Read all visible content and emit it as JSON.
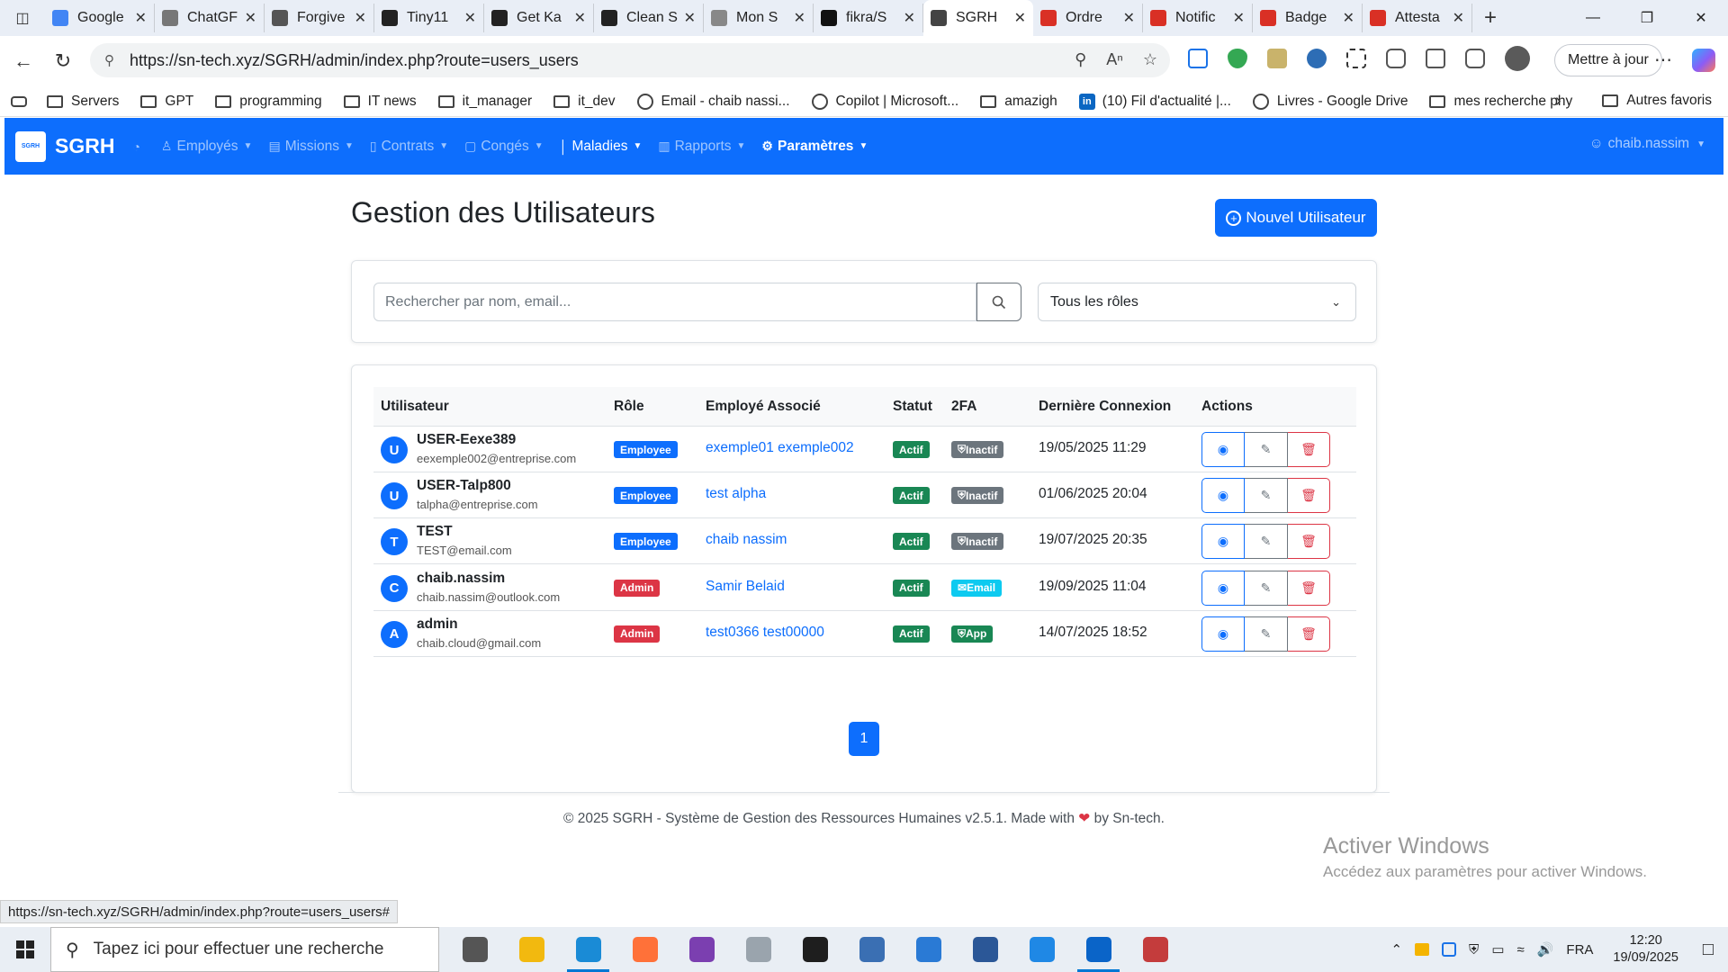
{
  "browser": {
    "tabs": [
      {
        "label": "Google",
        "icon": "gemini-icon",
        "color": "#4285f4"
      },
      {
        "label": "ChatGF",
        "icon": "chatgpt-icon",
        "color": "#777777"
      },
      {
        "label": "Forgive",
        "icon": "drive-icon",
        "color": "#555555"
      },
      {
        "label": "Tiny11",
        "icon": "tiny11-icon",
        "color": "#222222"
      },
      {
        "label": "Get Ka",
        "icon": "tool-icon",
        "color": "#222222"
      },
      {
        "label": "Clean S",
        "icon": "openai-icon",
        "color": "#222222"
      },
      {
        "label": "Mon S",
        "icon": "globe-icon",
        "color": "#888888"
      },
      {
        "label": "fikra/S",
        "icon": "github-icon",
        "color": "#111111"
      },
      {
        "label": "SGRH",
        "icon": "globe-icon",
        "color": "#444444",
        "active": true
      },
      {
        "label": "Ordre",
        "icon": "pdf-icon",
        "color": "#d93025"
      },
      {
        "label": "Notific",
        "icon": "pdf-icon",
        "color": "#d93025"
      },
      {
        "label": "Badge",
        "icon": "pdf-icon",
        "color": "#d93025"
      },
      {
        "label": "Attesta",
        "icon": "pdf-icon",
        "color": "#d93025"
      }
    ],
    "url": "https://sn-tech.xyz/SGRH/admin/index.php?route=users_users",
    "update_label": "Mettre à jour",
    "bookmarks": [
      {
        "label": "Servers",
        "type": "folder"
      },
      {
        "label": "GPT",
        "type": "folder"
      },
      {
        "label": "programming",
        "type": "folder"
      },
      {
        "label": "IT news",
        "type": "folder"
      },
      {
        "label": "it_manager",
        "type": "folder"
      },
      {
        "label": "it_dev",
        "type": "folder"
      },
      {
        "label": "Email - chaib nassi...",
        "type": "globe"
      },
      {
        "label": "Copilot | Microsoft...",
        "type": "globe"
      },
      {
        "label": "amazigh",
        "type": "folder"
      },
      {
        "label": "(10) Fil d'actualité |...",
        "type": "linkedin"
      },
      {
        "label": "Livres - Google Drive",
        "type": "globe"
      },
      {
        "label": "mes recherche phy",
        "type": "folder"
      }
    ],
    "other_bookmarks": "Autres favoris",
    "status_url": "https://sn-tech.xyz/SGRH/admin/index.php?route=users_users#"
  },
  "app": {
    "brand": "SGRH",
    "logo_text": "SGRH",
    "nav": [
      {
        "label": "",
        "icon": "dashboard-icon"
      },
      {
        "label": "Employés",
        "icon": "users-icon"
      },
      {
        "label": "Missions",
        "icon": "briefcase-icon"
      },
      {
        "label": "Contrats",
        "icon": "file-icon"
      },
      {
        "label": "Congés",
        "icon": "calendar-icon"
      },
      {
        "label": "Maladies",
        "icon": "thermometer-icon"
      },
      {
        "label": "Rapports",
        "icon": "report-icon"
      },
      {
        "label": "Paramètres",
        "icon": "gear-icon"
      }
    ],
    "user": "chaib.nassim"
  },
  "page": {
    "title": "Gestion des Utilisateurs",
    "new_user_label": "Nouvel Utilisateur",
    "search_placeholder": "Rechercher par nom, email...",
    "role_filter": "Tous les rôles"
  },
  "table": {
    "headers": [
      "Utilisateur",
      "Rôle",
      "Employé Associé",
      "Statut",
      "2FA",
      "Dernière Connexion",
      "Actions"
    ],
    "rows": [
      {
        "initial": "U",
        "name": "USER-Eexe389",
        "email": "eexemple002@entreprise.com",
        "role": "Employee",
        "employee": "exemple01 exemple002",
        "status": "Actif",
        "twofa": "Inactif",
        "last_login": "19/05/2025 11:29"
      },
      {
        "initial": "U",
        "name": "USER-Talp800",
        "email": "talpha@entreprise.com",
        "role": "Employee",
        "employee": "test alpha",
        "status": "Actif",
        "twofa": "Inactif",
        "last_login": "01/06/2025 20:04"
      },
      {
        "initial": "T",
        "name": "TEST",
        "email": "TEST@email.com",
        "role": "Employee",
        "employee": "chaib nassim",
        "status": "Actif",
        "twofa": "Inactif",
        "last_login": "19/07/2025 20:35"
      },
      {
        "initial": "C",
        "name": "chaib.nassim",
        "email": "chaib.nassim@outlook.com",
        "role": "Admin",
        "employee": "Samir Belaid",
        "status": "Actif",
        "twofa": "Email",
        "last_login": "19/09/2025 11:04"
      },
      {
        "initial": "A",
        "name": "admin",
        "email": "chaib.cloud@gmail.com",
        "role": "Admin",
        "employee": "test0366 test00000",
        "status": "Actif",
        "twofa": "App",
        "last_login": "14/07/2025 18:52"
      }
    ],
    "current_page": "1"
  },
  "footer": {
    "before": "© 2025 SGRH - Système de Gestion des Ressources Humaines v2.5.1. Made with",
    "after": "by Sn-tech."
  },
  "watermark": {
    "line1": "Activer Windows",
    "line2": "Accédez aux paramètres pour activer Windows."
  },
  "taskbar": {
    "search_placeholder": "Tapez ici pour effectuer une recherche",
    "lang": "FRA",
    "time": "12:20",
    "date": "19/09/2025",
    "apps": [
      {
        "name": "task-view-icon",
        "color": "#555555"
      },
      {
        "name": "file-explorer-icon",
        "color": "#f2b90f"
      },
      {
        "name": "edge-icon",
        "color": "#1a8bd6",
        "open": true
      },
      {
        "name": "firefox-icon",
        "color": "#ff7139"
      },
      {
        "name": "github-desktop-icon",
        "color": "#7b3fb0"
      },
      {
        "name": "app-icon",
        "color": "#9aa4ad"
      },
      {
        "name": "terminal-icon",
        "color": "#1e1e1e"
      },
      {
        "name": "network-app-icon",
        "color": "#3a6fb3"
      },
      {
        "name": "remote-app-icon",
        "color": "#2a7ad5"
      },
      {
        "name": "powershell-icon",
        "color": "#2b5797"
      },
      {
        "name": "vscode-icon",
        "color": "#1f88e5"
      },
      {
        "name": "outlook-icon",
        "color": "#0a64c8",
        "open": true
      },
      {
        "name": "paint-icon",
        "color": "#c43c3c"
      }
    ]
  }
}
